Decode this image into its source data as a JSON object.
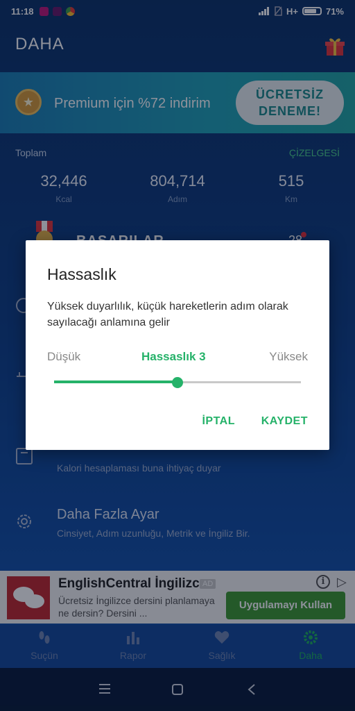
{
  "status_bar": {
    "time": "11:18",
    "network": "H+",
    "battery": "71%",
    "notification_icons": [
      "vpn-app-icon",
      "messenger-app-icon",
      "chrome-icon"
    ]
  },
  "app_bar": {
    "title": "DAHA"
  },
  "premium_banner": {
    "text": "Premium için %72 indirim",
    "button_line1": "ÜCRETSİZ",
    "button_line2": "DENEME!"
  },
  "totals": {
    "label": "Toplam",
    "chart_link": "ÇİZELGESİ",
    "stats": [
      {
        "value": "32,446",
        "unit": "Kcal"
      },
      {
        "value": "804,714",
        "unit": "Adım"
      },
      {
        "value": "515",
        "unit": "Km"
      }
    ]
  },
  "achievements": {
    "label": "BAŞARILAR",
    "count": "28"
  },
  "settings_rows": [
    {
      "title": "",
      "subtitle": "Kalori hesaplaması buna ihtiyaç duyar"
    },
    {
      "title": "Daha Fazla Ayar",
      "subtitle": "Cinsiyet, Adım uzunluğu, Metrik ve İngiliz Bir."
    }
  ],
  "ad": {
    "title": "EnglishCentral İngilizc...",
    "badge": "AD",
    "description": "Ücretsiz İngilizce dersini planlamaya ne dersin? Dersini ...",
    "cta": "Uygulamayı Kullan"
  },
  "bottom_nav": [
    {
      "label": "Suçün",
      "icon": "footsteps-icon"
    },
    {
      "label": "Rapor",
      "icon": "bar-chart-icon"
    },
    {
      "label": "Sağlık",
      "icon": "heart-icon"
    },
    {
      "label": "Daha",
      "icon": "gear-icon",
      "active": true
    }
  ],
  "dialog": {
    "title": "Hassaslık",
    "body": "Yüksek duyarlılık, küçük hareketlerin adım olarak sayılacağı anlamına gelir",
    "low_label": "Düşük",
    "current_label": "Hassaslık 3",
    "high_label": "Yüksek",
    "slider": {
      "min": 1,
      "max": 5,
      "value": 3
    },
    "cancel": "İPTAL",
    "save": "KAYDET"
  },
  "colors": {
    "accent": "#25b269",
    "app_bg": "#0f3f86",
    "ad_button": "#3f9a32"
  }
}
